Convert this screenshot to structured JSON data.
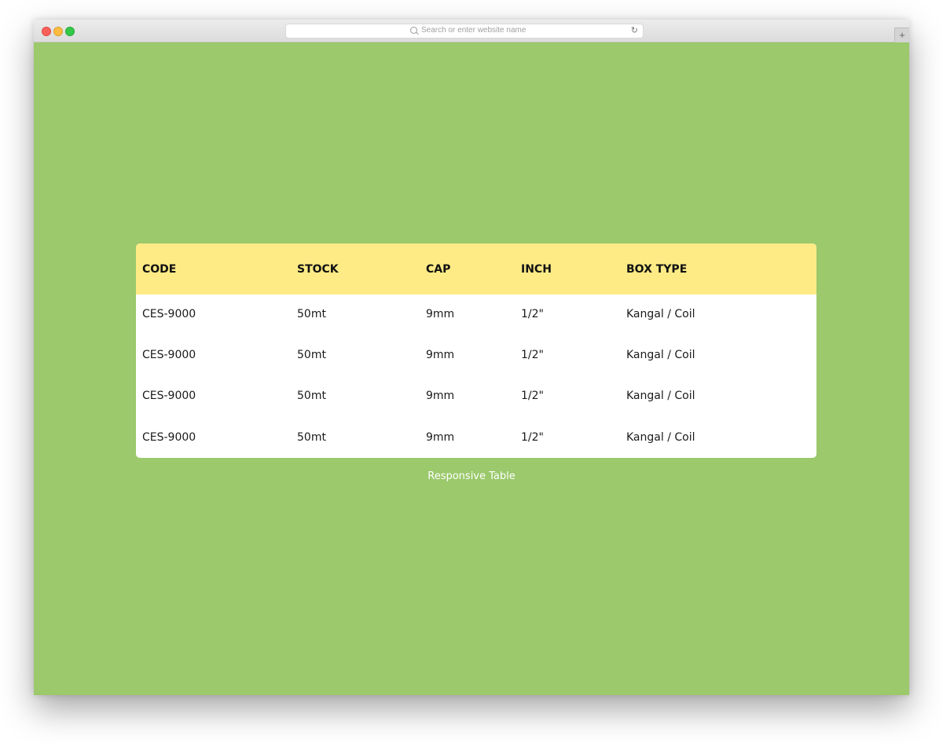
{
  "browser": {
    "address_placeholder": "Search or enter website name",
    "newtab_label": "+",
    "reload_glyph": "↻"
  },
  "colors": {
    "page_background": "#9bc96b",
    "header_background": "#feeb86",
    "table_background": "#ffffff",
    "caption_text": "#ffffff"
  },
  "table": {
    "headers": [
      "CODE",
      "STOCK",
      "CAP",
      "INCH",
      "BOX TYPE"
    ],
    "rows": [
      [
        "CES-9000",
        "50mt",
        "9mm",
        "1/2\"",
        "Kangal / Coil"
      ],
      [
        "CES-9000",
        "50mt",
        "9mm",
        "1/2\"",
        "Kangal / Coil"
      ],
      [
        "CES-9000",
        "50mt",
        "9mm",
        "1/2\"",
        "Kangal / Coil"
      ],
      [
        "CES-9000",
        "50mt",
        "9mm",
        "1/2\"",
        "Kangal / Coil"
      ]
    ]
  },
  "caption": "Responsive Table"
}
